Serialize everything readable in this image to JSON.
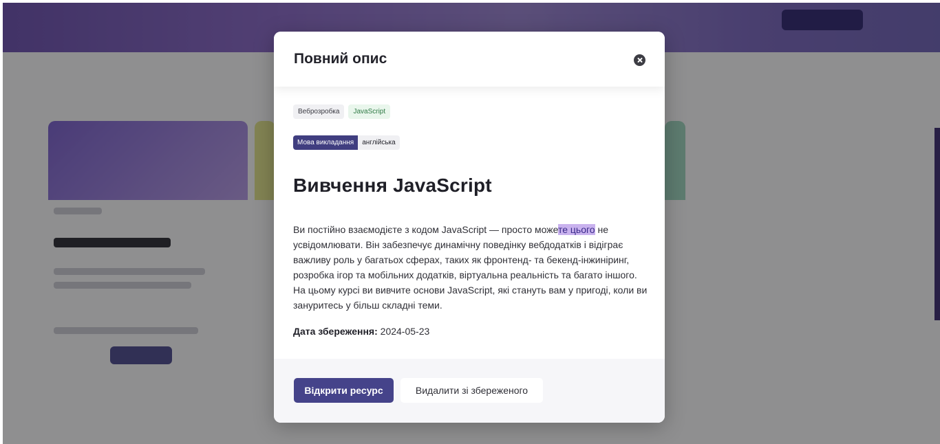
{
  "modal": {
    "title": "Повний опис",
    "tags": [
      "Веброзробка",
      "JavaScript"
    ],
    "language_label": "Мова викладання",
    "language_value": "англійська",
    "course_title": "Вивчення JavaScript",
    "description_part1": "Ви постійно взаємодієте з кодом JavaScript — просто може",
    "description_highlight": "те цього",
    "description_part2": " не усвідомлювати. Він забезпечує динамічну поведінку вебдодатків і відіграє важливу роль у багатьох сферах, таких як фронтенд- та бекенд-інжиніринг, розробка ігор та мобільних додатків, віртуальна реальність та багато іншого. На цьому курсі ви вивчите основи JavaScript, які стануть вам у пригоді, коли ви зануритесь у більш складні теми.",
    "saved_label": "Дата збереження:",
    "saved_value": "2024-05-23",
    "open_button": "Відкрити ресурс",
    "remove_button": "Видалити зі збереженого"
  },
  "colors": {
    "primary": "#45438a",
    "highlight": "#c9b2ee",
    "tag_green_text": "#2f7a45"
  },
  "icons": {
    "close": "close-circle-icon"
  }
}
